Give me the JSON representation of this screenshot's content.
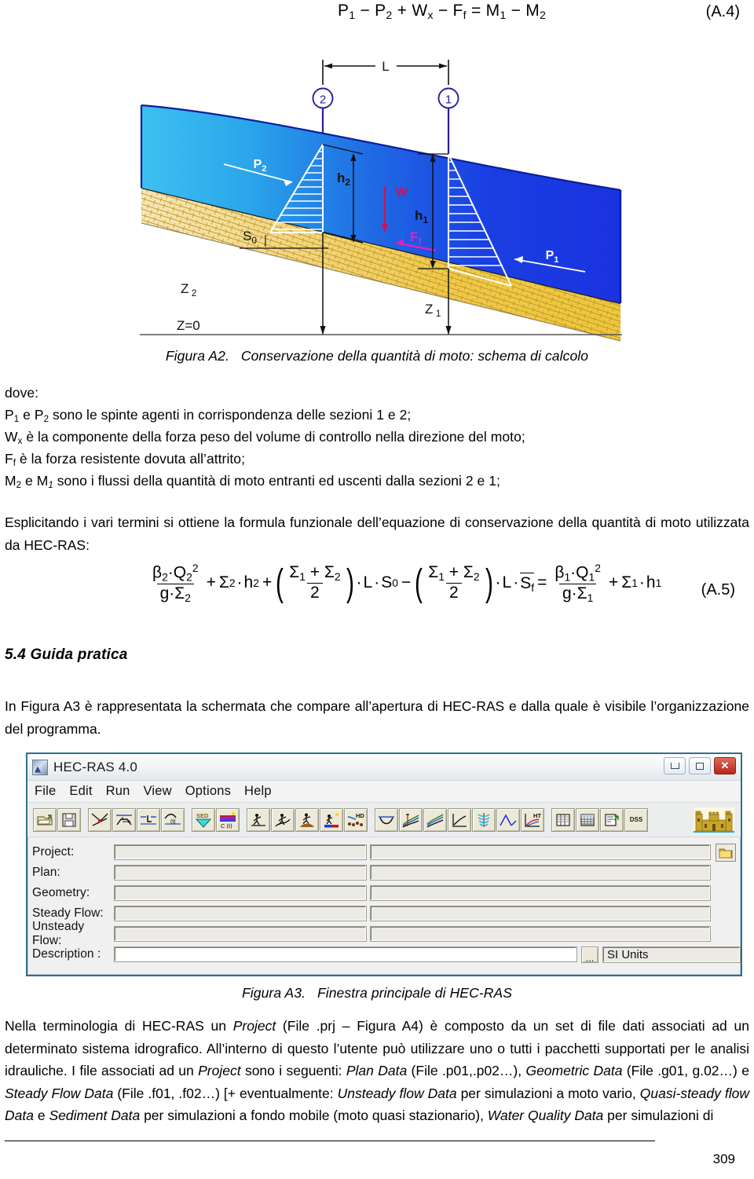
{
  "equations": {
    "a4": {
      "number": "(A.4)",
      "latex_plain": "P1 - P2 + Wx - Ff = M1 - M2",
      "terms": [
        "P",
        "1",
        "-",
        "P",
        "2",
        "+",
        "W",
        "x",
        "-",
        "F",
        "f",
        "=",
        "M",
        "1",
        "-",
        "M",
        "2"
      ]
    },
    "a5": {
      "number": "(A.5)",
      "latex_plain": "(beta2*Q2^2)/(g*Sigma2) + Sigma2*h2 + ((Sigma1+Sigma2)/2)*L*S0 - ((Sigma1+Sigma2)/2)*L*Sf_bar = (beta1*Q1^2)/(g*Sigma1) + Sigma1*h1"
    }
  },
  "figureA2": {
    "caption_label": "Figura A2.",
    "caption_text": "Conservazione della quantità di moto: schema di calcolo",
    "labels": {
      "length": "L",
      "section_upstream": "2",
      "section_downstream": "1",
      "pressure_upstream": "P",
      "pressure_upstream_sub": "2",
      "pressure_downstream": "P",
      "pressure_downstream_sub": "1",
      "depth_upstream": "h",
      "depth_upstream_sub": "2",
      "depth_downstream": "h",
      "depth_downstream_sub": "1",
      "weight": "W",
      "friction": "F",
      "friction_sub": "f",
      "bed_slope": "S",
      "bed_slope_sub": "0",
      "elev_upstream": "Z",
      "elev_upstream_sub": "2",
      "elev_downstream": "Z",
      "elev_downstream_sub": "1",
      "datum": "Z=0"
    },
    "colors": {
      "water_light": "#3bb8ee",
      "water_dark": "#1a3ce0",
      "bed_fill": "#f0cf76",
      "bed_fill_light": "#f3e2b0",
      "section_line": "#2a1f9e",
      "weight_arrow": "#c2185b",
      "friction_arrow": "#e020c0",
      "pressure_arrow": "#ffffff"
    }
  },
  "text": {
    "dove": "dove:",
    "defs": [
      {
        "pre": "P",
        "sub1": "1",
        "mid": " e P",
        "sub2": "2",
        "post": " sono le spinte agenti in corrispondenza delle sezioni 1 e 2;"
      },
      {
        "pre": "W",
        "sub1": "x",
        "mid": "",
        "sub2": "",
        "post": " è la componente della forza peso del volume di controllo nella direzione del moto;"
      },
      {
        "pre": "F",
        "sub1": "f",
        "mid": "",
        "sub2": "",
        "post": " è la forza resistente dovuta all’attrito;"
      },
      {
        "pre": "M",
        "sub1": "2",
        "mid": " e M",
        "sub2": "1",
        "post": " sono i flussi della quantità di moto entranti ed uscenti dalla sezioni 2 e 1;"
      }
    ],
    "paragraph_esplicitando": "Esplicitando i vari termini si ottiene la formula funzionale dell’equazione di conservazione della quantità di moto utilizzata da HEC-RAS:",
    "section_heading": "5.4 Guida pratica",
    "paragraph_infigura": "In Figura A3 è rappresentata la schermata che compare all’apertura di HEC-RAS e dalla quale è visibile l’organizzazione del programma.",
    "paragraph_terminologia_html": "Nella terminologia di HEC-RAS un <i>Project</i> (File .prj – Figura A4) è composto da un set di file dati associati ad un determinato sistema idrografico. All’interno di questo l’utente può utilizzare uno o tutti i pacchetti supportati per le analisi idrauliche. I file associati ad un <i>Project</i> sono i seguenti: <i>Plan Data</i> (File .p01,.p02…), <i>Geometric Data</i> (File .g01, g.02…) e <i>Steady Flow Data</i> (File .f01, .f02…) [+ eventualmente: <i>Unsteady flow Data</i> per simulazioni a moto vario, <i>Quasi-steady flow Data</i> e <i>Sediment Data</i> per simulazioni a fondo mobile (moto quasi stazionario), <i>Water Quality Data</i> per simulazioni di"
  },
  "figureA3": {
    "caption_label": "Figura A3.",
    "caption_text": "Finestra principale di HEC-RAS"
  },
  "hecras": {
    "title": "HEC-RAS 4.0",
    "window_buttons": {
      "minimize": "",
      "maximize": "",
      "close": "✕"
    },
    "menu": [
      "File",
      "Edit",
      "Run",
      "View",
      "Options",
      "Help"
    ],
    "toolbar_groups": [
      [
        "open-project-icon",
        "save-project-icon"
      ],
      [
        "river-schematic-icon",
        "cross-section-data-icon",
        "steady-flow-data-icon",
        "unsteady-flow-data-icon"
      ],
      [
        "sediment-data-icon",
        "water-quality-data-icon"
      ],
      [
        "steady-flow-analysis-icon",
        "unsteady-flow-analysis-icon",
        "sediment-analysis-icon",
        "water-quality-analysis-icon",
        "hydraulic-design-icon"
      ],
      [
        "cross-section-plot-icon",
        "profile-plot-icon",
        "general-profile-plot-icon",
        "rating-curve-icon",
        "xyz-perspective-icon",
        "stage-flow-hydrograph-icon",
        "hydraulic-property-plot-icon"
      ],
      [
        "detailed-output-table-icon",
        "profile-summary-table-icon",
        "summary-report-icon",
        "dss-icon"
      ]
    ],
    "toolbar_labels": {
      "sed": "SED",
      "ct": "C (t)",
      "hd": "HD",
      "ht": "HT",
      "dss": "DSS"
    },
    "fields": [
      {
        "label": "Project:",
        "value": "",
        "placeholder": ""
      },
      {
        "label": "Plan:",
        "value": "",
        "placeholder": ""
      },
      {
        "label": "Geometry:",
        "value": "",
        "placeholder": ""
      },
      {
        "label": "Steady Flow:",
        "value": "",
        "placeholder": ""
      },
      {
        "label": "Unsteady Flow:",
        "value": "",
        "placeholder": ""
      },
      {
        "label": "Description :",
        "value": "",
        "placeholder": ""
      }
    ],
    "description_dots": "...",
    "units": "SI Units",
    "colors": {
      "window_border": "#2f6f8f",
      "toolbar_face": "#ece9d8",
      "field_face": "#eceae4"
    }
  },
  "footer": {
    "page_number": "309"
  }
}
